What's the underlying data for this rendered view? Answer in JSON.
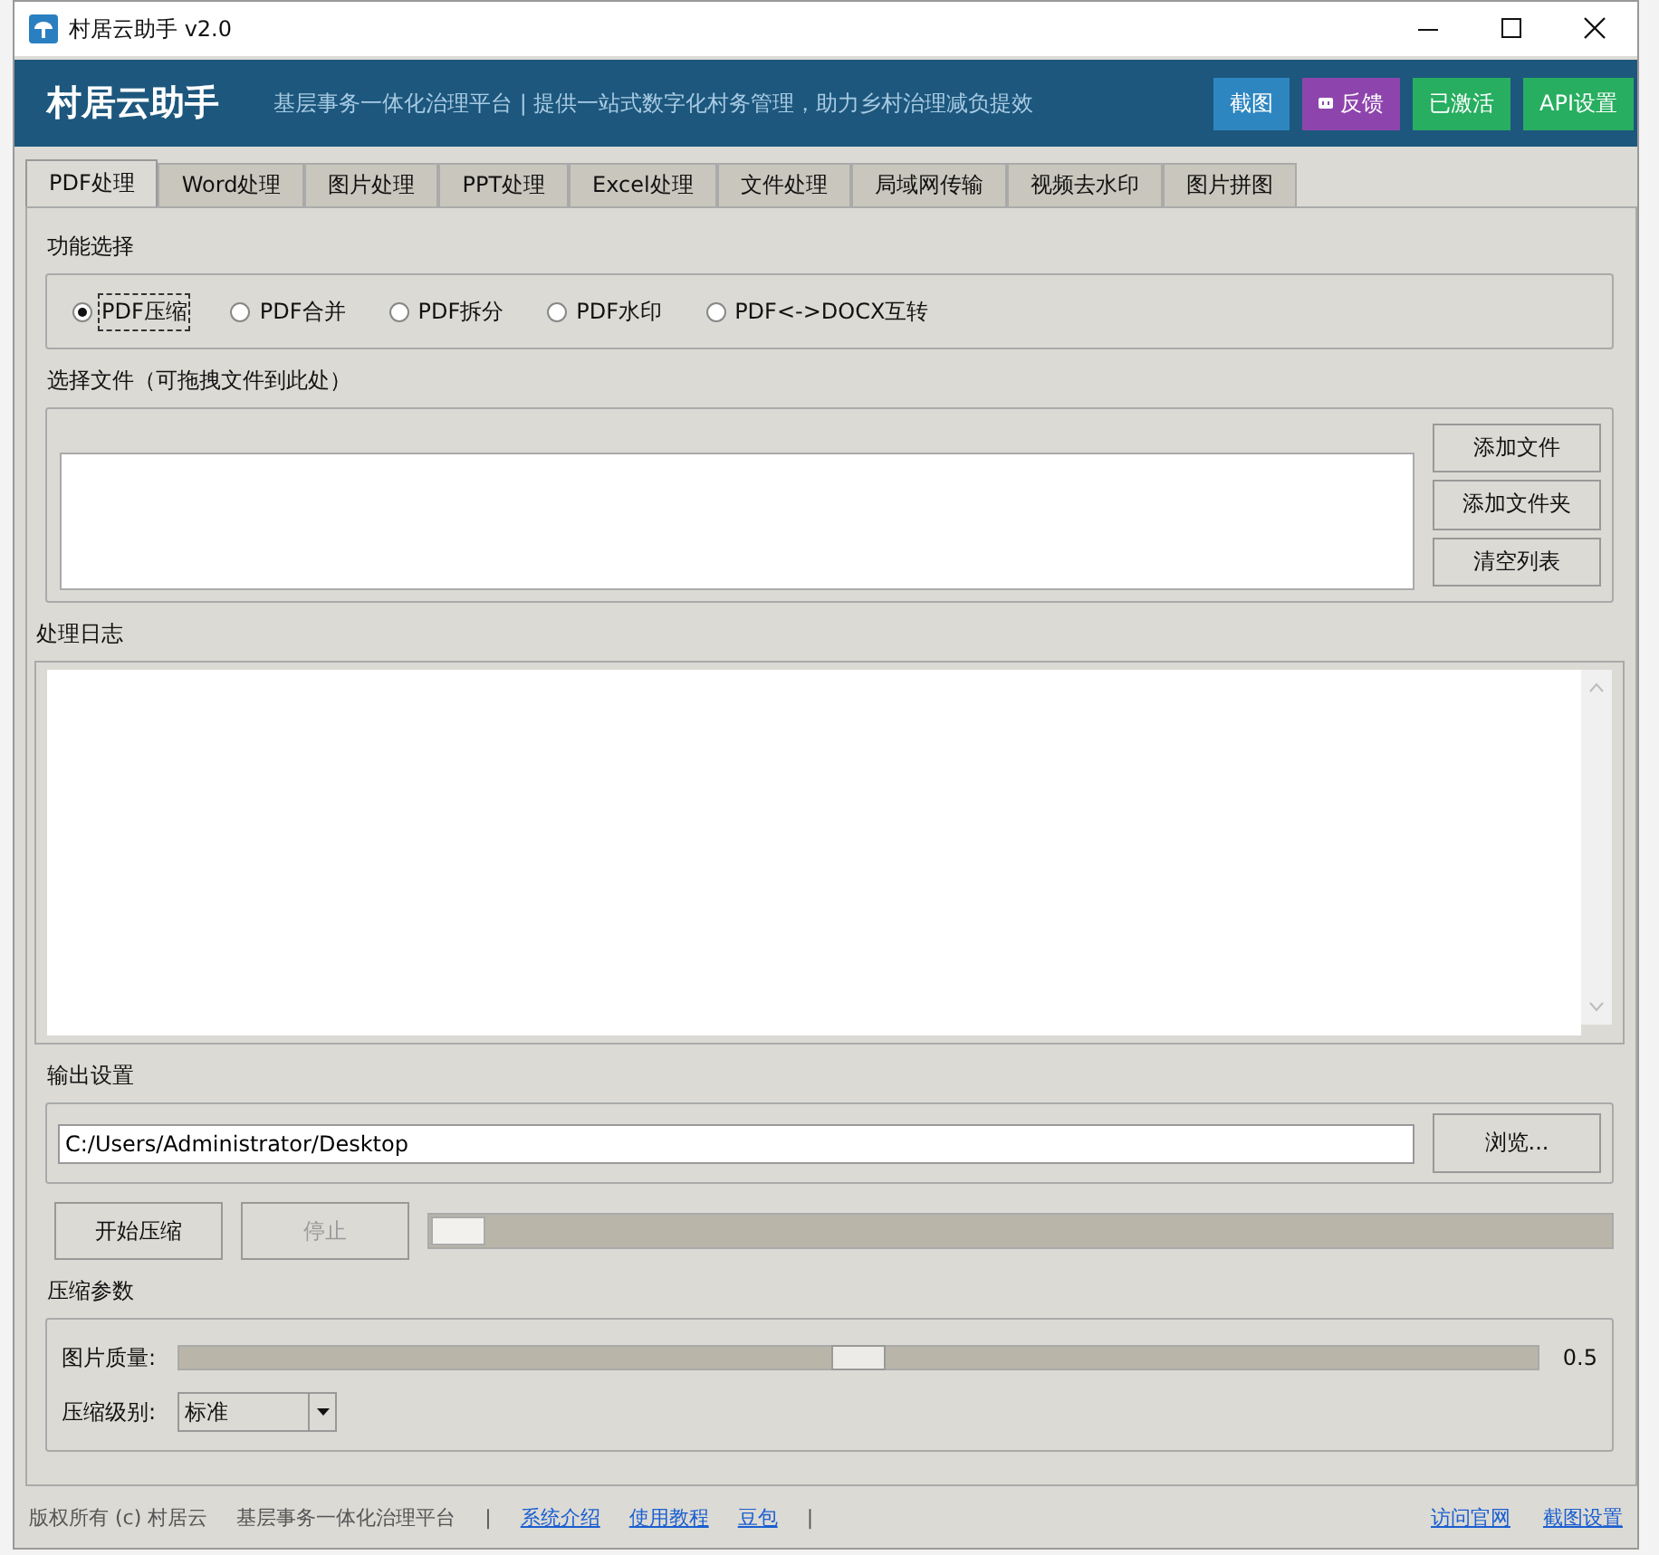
{
  "window": {
    "title": "村居云助手 v2.0"
  },
  "header": {
    "brand": "村居云助手",
    "subtitle": "基层事务一体化治理平台 | 提供一站式数字化村务管理，助力乡村治理减负提效",
    "buttons": [
      {
        "label": "截图",
        "kind": "plain",
        "color": "#2e86c1"
      },
      {
        "label": "反馈",
        "kind": "with-icon",
        "color": "#8e44ad"
      },
      {
        "label": "已激活",
        "kind": "plain",
        "color": "#27ae60"
      },
      {
        "label": "API设置",
        "kind": "plain",
        "color": "#27ae60"
      }
    ]
  },
  "tabs": [
    {
      "label": "PDF处理",
      "selected": true
    },
    {
      "label": "Word处理",
      "selected": false
    },
    {
      "label": "图片处理",
      "selected": false
    },
    {
      "label": "PPT处理",
      "selected": false
    },
    {
      "label": "Excel处理",
      "selected": false
    },
    {
      "label": "文件处理",
      "selected": false
    },
    {
      "label": "局域网传输",
      "selected": false
    },
    {
      "label": "视频去水印",
      "selected": false
    },
    {
      "label": "图片拼图",
      "selected": false
    }
  ],
  "function_select": {
    "title": "功能选择",
    "options": [
      {
        "label": "PDF压缩",
        "selected": true
      },
      {
        "label": "PDF合并",
        "selected": false
      },
      {
        "label": "PDF拆分",
        "selected": false
      },
      {
        "label": "PDF水印",
        "selected": false
      },
      {
        "label": "PDF<->DOCX互转",
        "selected": false
      }
    ]
  },
  "file_select": {
    "title": "选择文件（可拖拽文件到此处）",
    "buttons": [
      "添加文件",
      "添加文件夹",
      "清空列表"
    ]
  },
  "log": {
    "title": "处理日志"
  },
  "output": {
    "title": "输出设置",
    "path": "C:/Users/Administrator/Desktop",
    "browse": "浏览..."
  },
  "actions": {
    "start": {
      "label": "开始压缩",
      "disabled": false
    },
    "stop": {
      "label": "停止",
      "disabled": true
    },
    "progress": {
      "level": 0.0
    }
  },
  "params": {
    "title": "压缩参数",
    "quality": {
      "label": "图片质量:",
      "level": 0.5,
      "reading": "0.5"
    },
    "compress_level": {
      "label": "压缩级别:",
      "value": "标准"
    }
  },
  "footer": {
    "left": [
      {
        "kind": "text",
        "text": "版权所有 (c) 村居云"
      },
      {
        "kind": "text",
        "text": "基层事务一体化治理平台"
      },
      {
        "kind": "separator",
        "text": "|"
      },
      {
        "kind": "link",
        "text": "系统介绍"
      },
      {
        "kind": "link",
        "text": "使用教程"
      },
      {
        "kind": "link",
        "text": "豆包"
      },
      {
        "kind": "separator",
        "text": "|"
      }
    ],
    "right": [
      {
        "kind": "link",
        "text": "访问官网"
      },
      {
        "kind": "link",
        "text": "截图设置"
      }
    ]
  }
}
